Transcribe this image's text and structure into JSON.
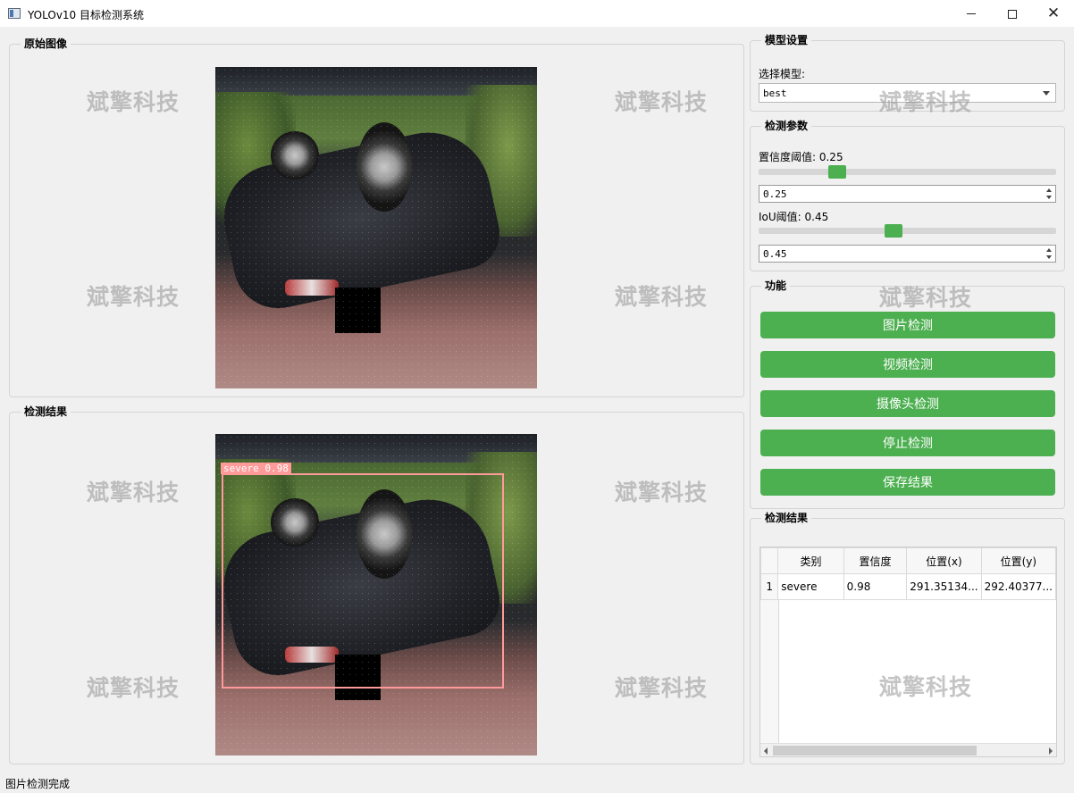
{
  "window": {
    "title": "YOLOv10 目标检测系统",
    "minimize_icon": "minimize-icon",
    "maximize_icon": "maximize-icon",
    "close_glyph": "✕"
  },
  "watermark": "斌擎科技",
  "original_panel": {
    "title": "原始图像"
  },
  "result_panel": {
    "title": "检测结果",
    "detection_label": "severe  0.98"
  },
  "model_settings": {
    "title": "模型设置",
    "select_label": "选择模型:",
    "selected_model": "best"
  },
  "detect_params": {
    "title": "检测参数",
    "confidence_label": "置信度阈值: 0.25",
    "confidence_value": "0.25",
    "confidence_level": 0.25,
    "iou_label": "IoU阈值: 0.45",
    "iou_value": "0.45",
    "iou_level": 0.45
  },
  "functions": {
    "title": "功能",
    "buttons": [
      "图片检测",
      "视频检测",
      "摄像头检测",
      "停止检测",
      "保存结果"
    ]
  },
  "results_table": {
    "title": "检测结果",
    "headers": [
      "类别",
      "置信度",
      "位置(x)",
      "位置(y)"
    ],
    "rows": [
      {
        "index": "1",
        "cells": [
          "severe",
          "0.98",
          "291.35134...",
          "292.40377..."
        ]
      }
    ]
  },
  "status_bar": {
    "text": "图片检测完成"
  },
  "colors": {
    "accent_green": "#4caf50",
    "detection_box": "#ff9a9a",
    "background": "#f0f0f0"
  }
}
